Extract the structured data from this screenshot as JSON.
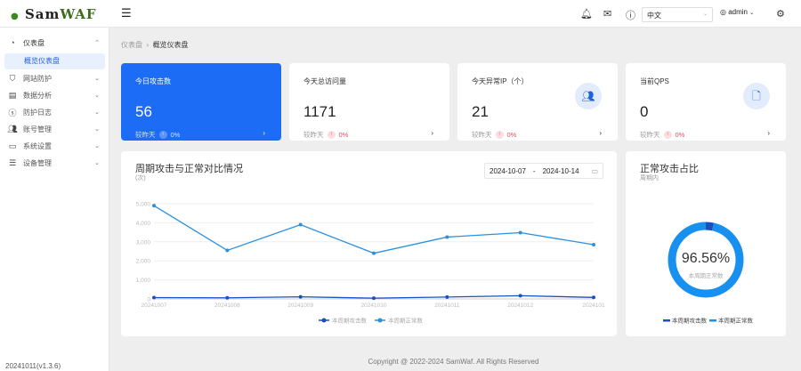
{
  "header": {
    "logo_sam": "Sam",
    "logo_waf": "WAF",
    "language": "中文",
    "user": "admin"
  },
  "sidebar": {
    "items": [
      {
        "label": "仪表盘",
        "icon": "dashboard-icon",
        "expanded": true
      },
      {
        "label": "网站防护",
        "icon": "shield-icon"
      },
      {
        "label": "数据分析",
        "icon": "chart-icon"
      },
      {
        "label": "防护日志",
        "icon": "log-icon"
      },
      {
        "label": "账号管理",
        "icon": "users-icon"
      },
      {
        "label": "系统设置",
        "icon": "settings-icon"
      },
      {
        "label": "设备管理",
        "icon": "device-icon"
      }
    ],
    "sub_item": "概览仪表盘",
    "version": "20241011(v1.3.6)"
  },
  "breadcrumb": {
    "root": "仪表盘",
    "current": "概览仪表盘"
  },
  "stats": [
    {
      "title": "今日攻击数",
      "value": "56",
      "compare": "较昨天",
      "pct": "0%"
    },
    {
      "title": "今天总访问量",
      "value": "1171",
      "compare": "较昨天",
      "pct": "0%"
    },
    {
      "title": "今天异常IP（个）",
      "value": "21",
      "compare": "较昨天",
      "pct": "0%",
      "icon": "users-icon"
    },
    {
      "title": "当前QPS",
      "value": "0",
      "compare": "较昨天",
      "pct": "0%",
      "icon": "file-icon"
    }
  ],
  "trend": {
    "title": "周期攻击与正常对比情况",
    "unit": "(次)",
    "date_start": "2024-10-07",
    "date_sep": "-",
    "date_end": "2024-10-14"
  },
  "ratio": {
    "title": "正常攻击占比",
    "subtitle": "周期内",
    "value": "96.56%",
    "center_label": "本周期正常数"
  },
  "footer": "Copyright @ 2022-2024 SamWaf. All Rights Reserved",
  "chart_data": [
    {
      "type": "line",
      "categories": [
        "20241007",
        "20241008",
        "20241009",
        "20241010",
        "20241011",
        "20241012",
        "2024101"
      ],
      "ylim": [
        0,
        5000
      ],
      "yticks": [
        "0",
        "1,000",
        "2,000",
        "3,000",
        "4,000",
        "5,000"
      ],
      "grid": true,
      "legend": "bottom",
      "series": [
        {
          "name": "本周期攻击数",
          "color": "#1a4fc4",
          "values": [
            70,
            60,
            110,
            40,
            100,
            170,
            80
          ]
        },
        {
          "name": "本周期正常数",
          "color": "#2b8fe0",
          "values": [
            4900,
            2550,
            3900,
            2400,
            3250,
            3480,
            2850
          ]
        }
      ]
    },
    {
      "type": "pie",
      "legend": "bottom",
      "slices": [
        {
          "name": "本周期攻击数",
          "value": 3.44,
          "color": "#1a4fc4"
        },
        {
          "name": "本周期正常数",
          "value": 96.56,
          "color": "#1890f0"
        }
      ]
    }
  ]
}
